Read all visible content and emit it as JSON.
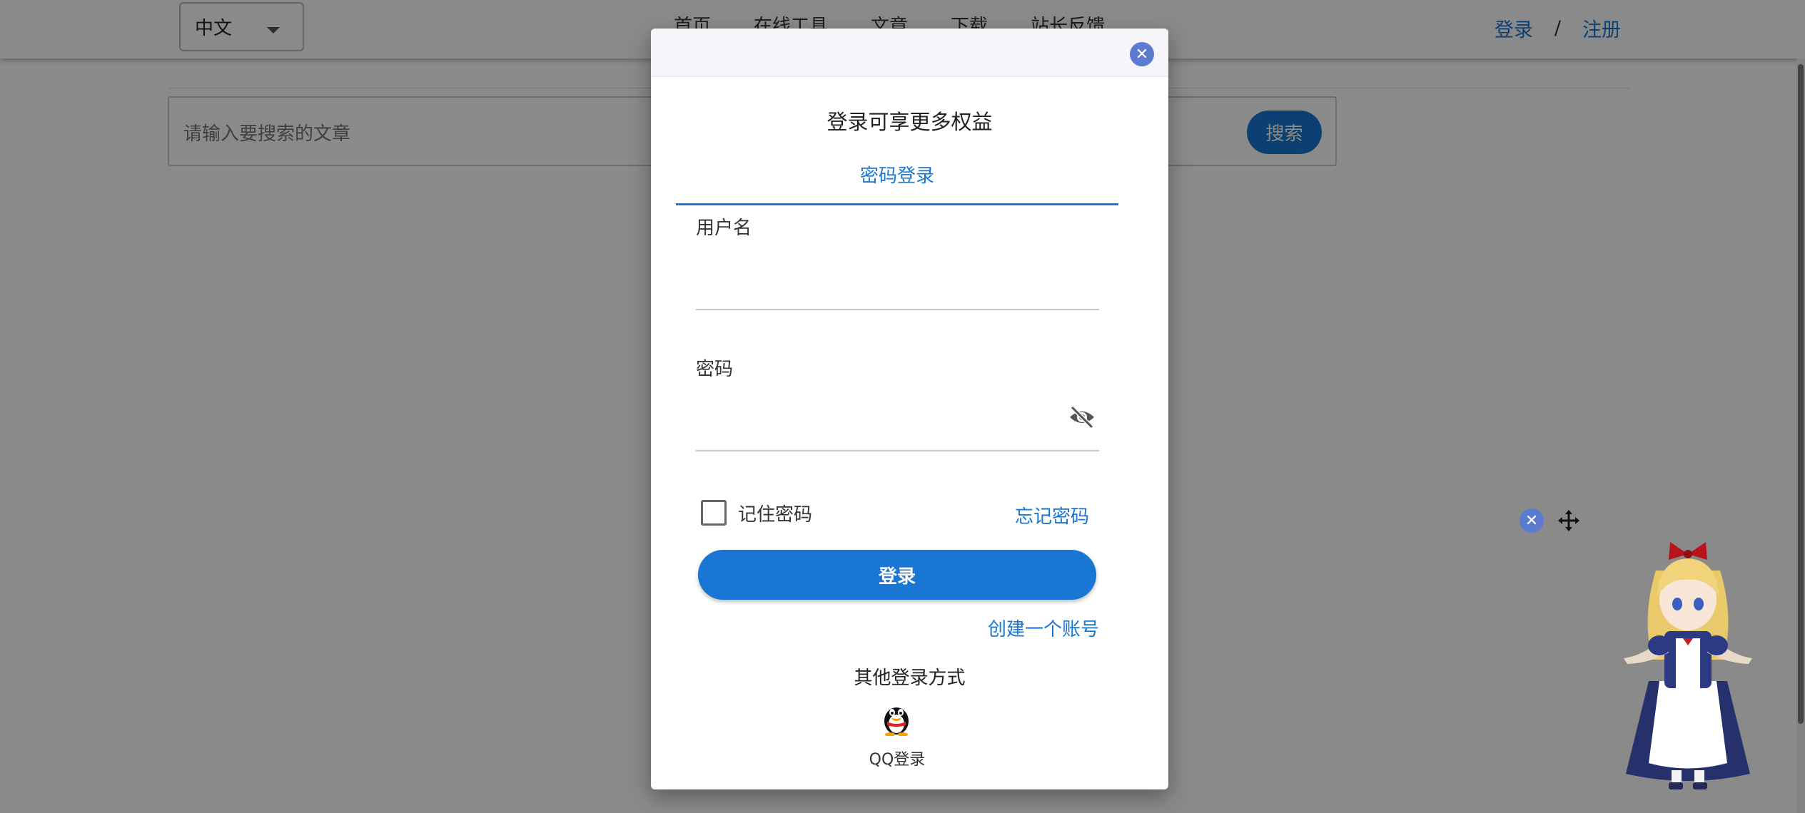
{
  "header": {
    "language": "中文",
    "nav": [
      "首页",
      "在线工具",
      "文章",
      "下载",
      "站长反馈"
    ],
    "auth": {
      "login": "登录",
      "separator": "/",
      "register": "注册"
    }
  },
  "search": {
    "placeholder": "请输入要搜索的文章",
    "button": "搜索"
  },
  "dialog": {
    "title": "登录可享更多权益",
    "tab": "密码登录",
    "username_label": "用户名",
    "username_value": "",
    "password_label": "密码",
    "password_value": "",
    "remember_label": "记住密码",
    "remember_checked": false,
    "forgot_link": "忘记密码",
    "login_button": "登录",
    "create_account": "创建一个账号",
    "other_methods": "其他登录方式",
    "qq_label": "QQ登录",
    "close_icon": "close-icon"
  },
  "colors": {
    "primary": "#1976d2",
    "close_badge": "#5b7bd0"
  }
}
